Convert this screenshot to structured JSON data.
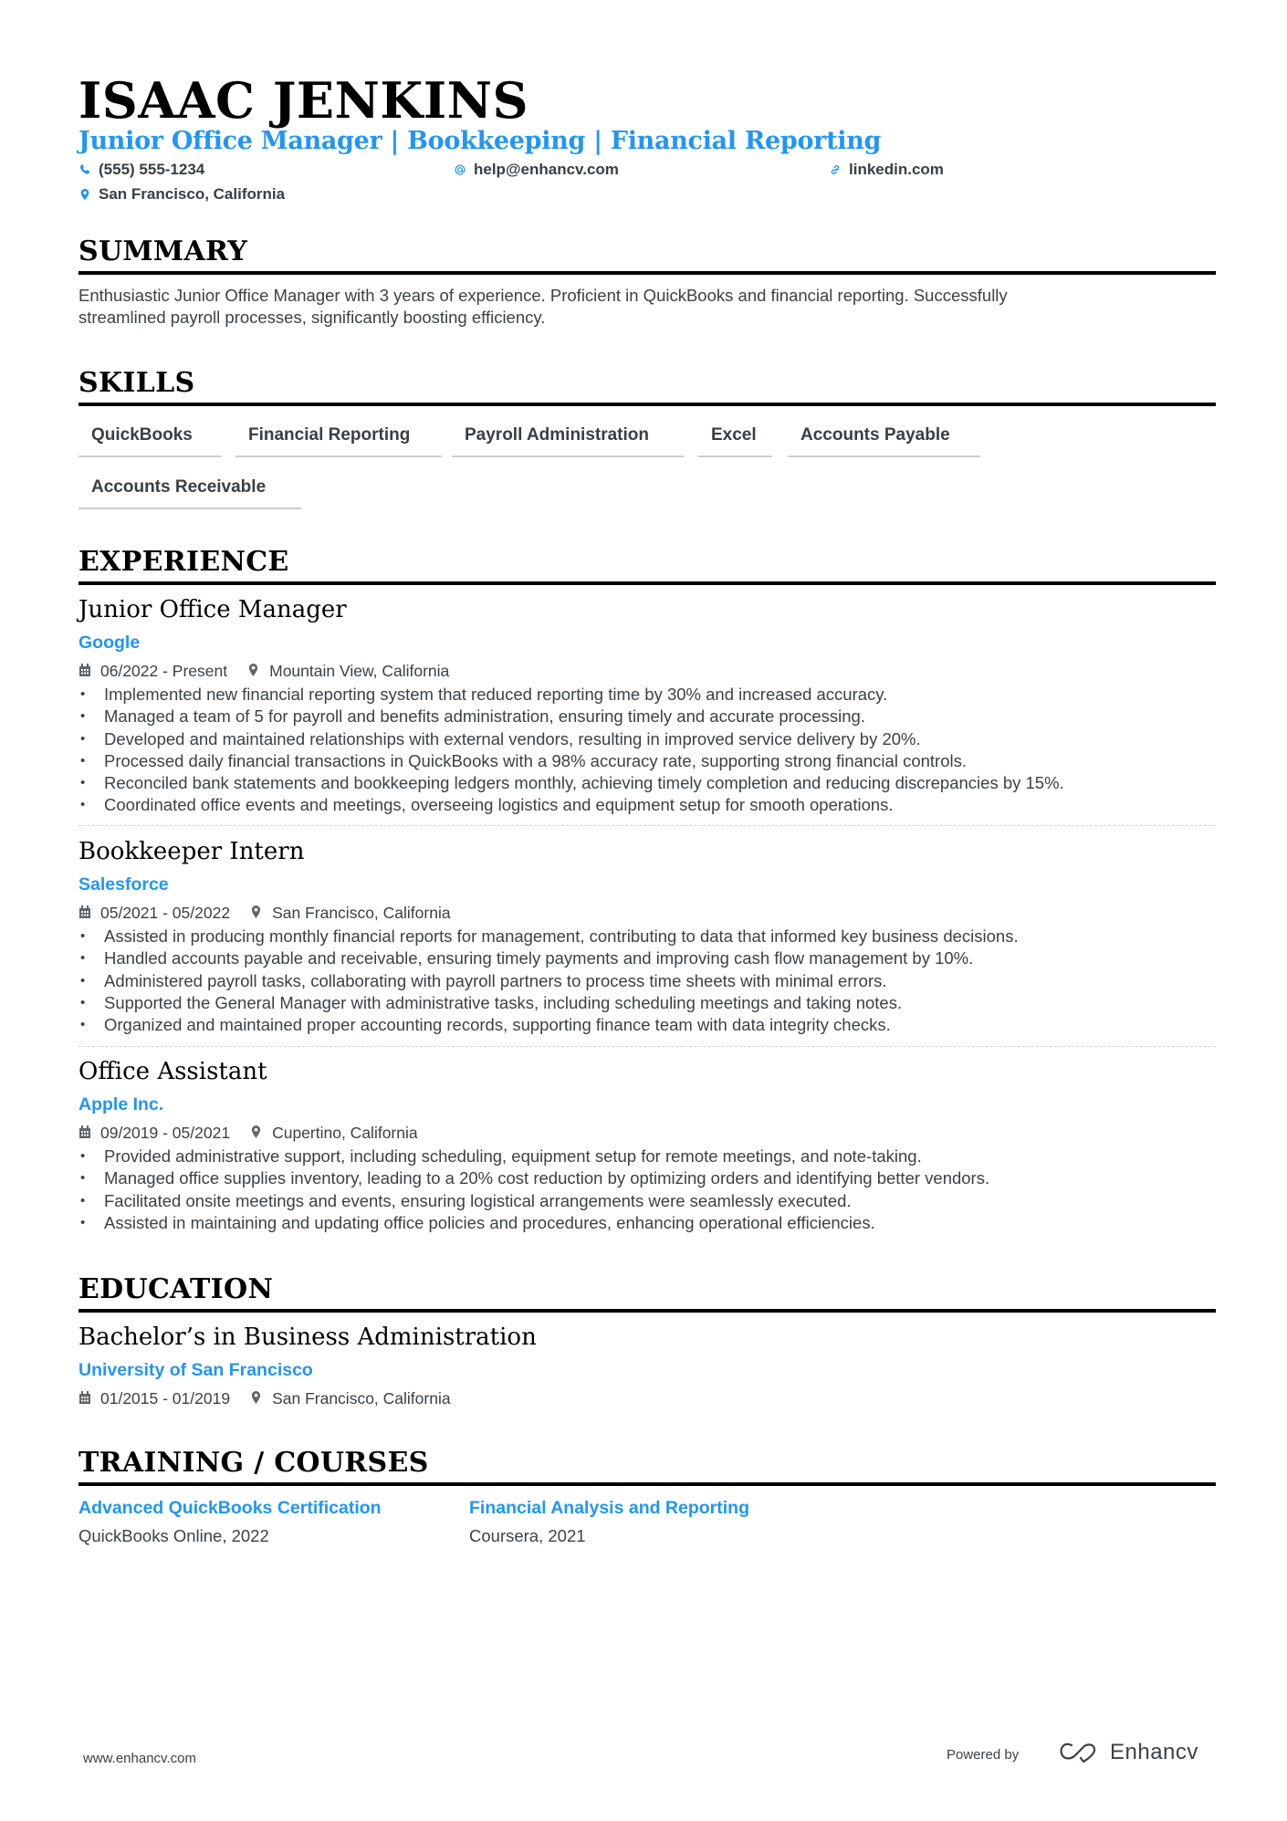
{
  "header": {
    "name": "ISAAC JENKINS",
    "subtitle": "Junior Office Manager | Bookkeeping | Financial Reporting",
    "contacts": {
      "phone": {
        "icon": "phone-icon",
        "value": "(555) 555-1234"
      },
      "email": {
        "icon": "at-icon",
        "value": "help@enhancv.com"
      },
      "linkedin": {
        "icon": "link-icon",
        "value": "linkedin.com"
      },
      "location": {
        "icon": "map-pin-icon",
        "value": "San Francisco, California"
      }
    }
  },
  "summary": {
    "heading": "SUMMARY",
    "lines": [
      "Enthusiastic Junior Office Manager with 3 years of experience. Proficient in QuickBooks and financial reporting. Successfully",
      "streamlined payroll processes, significantly boosting efficiency."
    ]
  },
  "skills": {
    "heading": "SKILLS",
    "items": [
      "QuickBooks",
      "Financial Reporting",
      "Payroll Administration",
      "Excel",
      "Accounts Payable",
      "Accounts Receivable"
    ]
  },
  "experience": {
    "heading": "EXPERIENCE",
    "jobs": [
      {
        "title": "Junior Office Manager",
        "company": "Google",
        "dates": "06/2022 - Present",
        "location": "Mountain View, California",
        "bullets": [
          "Implemented new financial reporting system that reduced reporting time by 30% and increased accuracy.",
          "Managed a team of 5 for payroll and benefits administration, ensuring timely and accurate processing.",
          "Developed and maintained relationships with external vendors, resulting in improved service delivery by 20%.",
          "Processed daily financial transactions in QuickBooks with a 98% accuracy rate, supporting strong financial controls.",
          "Reconciled bank statements and bookkeeping ledgers monthly, achieving timely completion and reducing discrepancies by 15%.",
          "Coordinated office events and meetings, overseeing logistics and equipment setup for smooth operations."
        ]
      },
      {
        "title": "Bookkeeper Intern",
        "company": "Salesforce",
        "dates": "05/2021 - 05/2022",
        "location": "San Francisco, California",
        "bullets": [
          "Assisted in producing monthly financial reports for management, contributing to data that informed key business decisions.",
          "Handled accounts payable and receivable, ensuring timely payments and improving cash flow management by 10%.",
          "Administered payroll tasks, collaborating with payroll partners to process time sheets with minimal errors.",
          "Supported the General Manager with administrative tasks, including scheduling meetings and taking notes.",
          "Organized and maintained proper accounting records, supporting finance team with data integrity checks."
        ]
      },
      {
        "title": "Office Assistant",
        "company": "Apple Inc.",
        "dates": "09/2019 - 05/2021",
        "location": "Cupertino, California",
        "bullets": [
          "Provided administrative support, including scheduling, equipment setup for remote meetings, and note-taking.",
          "Managed office supplies inventory, leading to a 20% cost reduction by optimizing orders and identifying better vendors.",
          "Facilitated onsite meetings and events, ensuring logistical arrangements were seamlessly executed.",
          "Assisted in maintaining and updating office policies and procedures, enhancing operational efficiencies."
        ]
      }
    ]
  },
  "education": {
    "heading": "EDUCATION",
    "degree": "Bachelor’s in Business Administration",
    "school": "University of San Francisco",
    "dates": "01/2015 - 01/2019",
    "location": "San Francisco, California"
  },
  "training": {
    "heading": "TRAINING / COURSES",
    "courses": [
      {
        "title": "Advanced QuickBooks Certification",
        "detail": "QuickBooks Online, 2022"
      },
      {
        "title": "Financial Analysis and Reporting",
        "detail": "Coursera, 2021"
      }
    ]
  },
  "footer": {
    "url": "www.enhancv.com",
    "powered_by": "Powered by",
    "brand": "Enhancv"
  },
  "colors": {
    "accent": "#2196f3",
    "heading": "#000000",
    "body_text": "#3b4146",
    "divider": "#cfd3d6"
  }
}
